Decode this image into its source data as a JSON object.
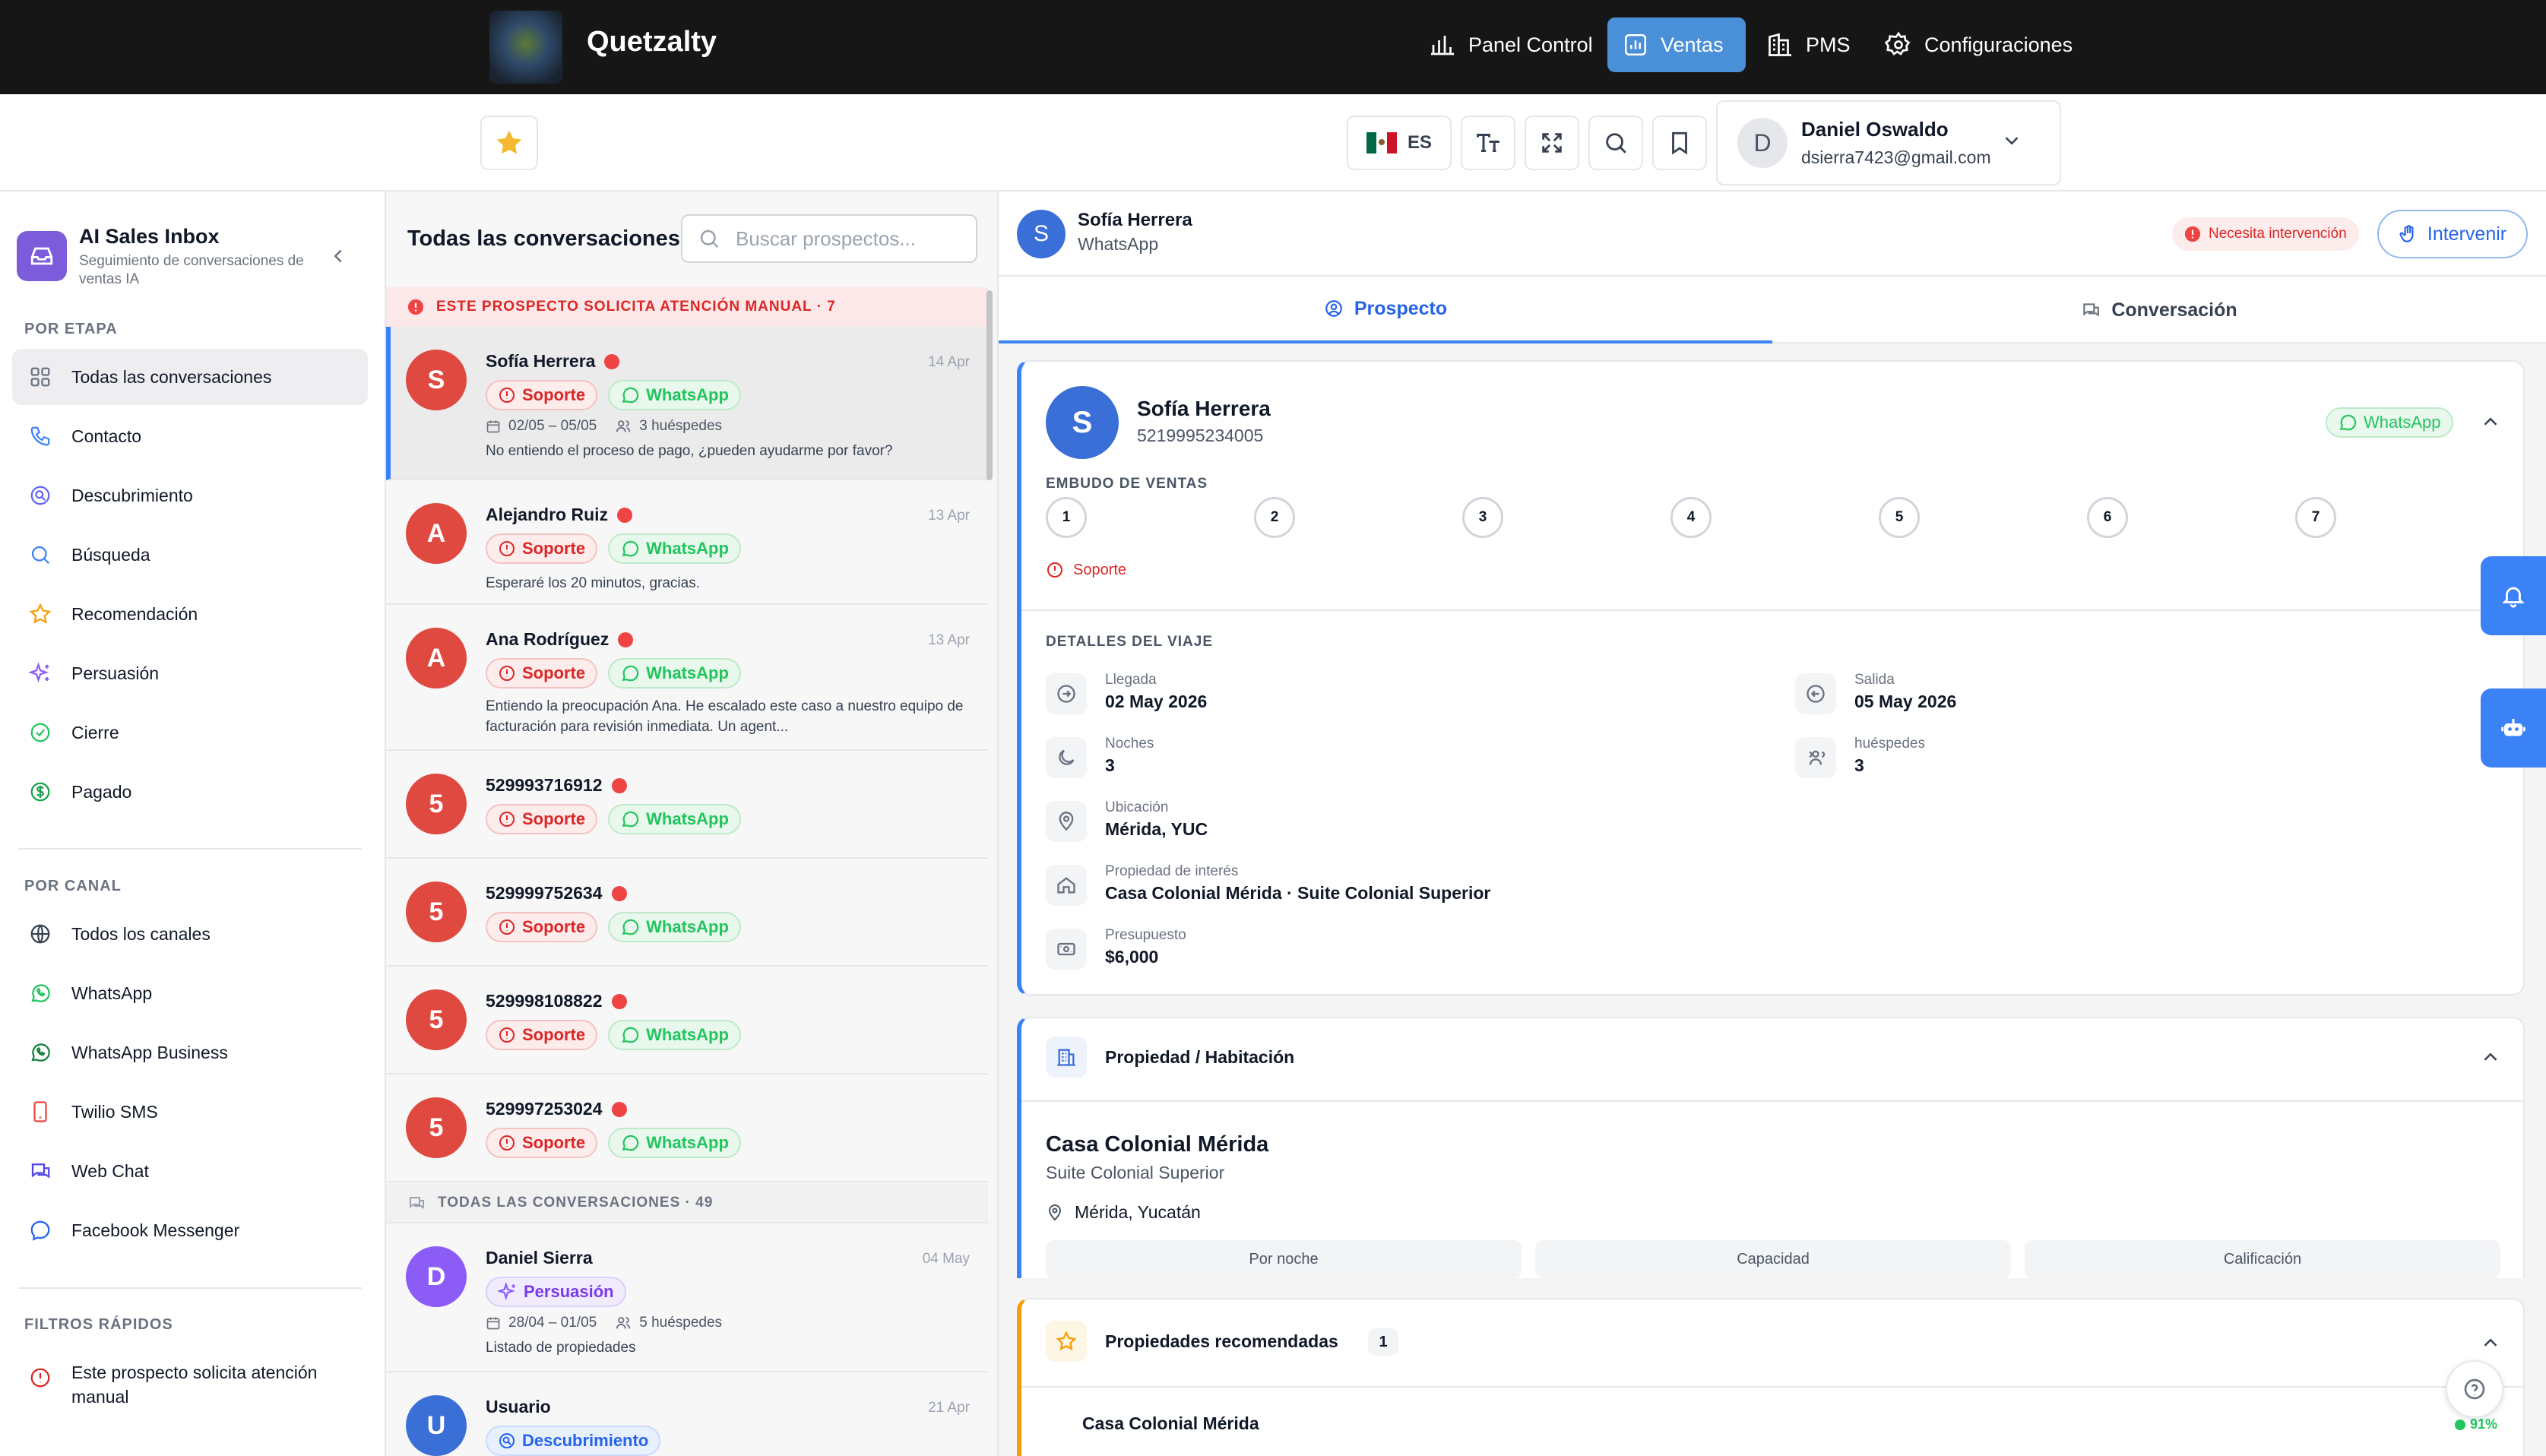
{
  "app": {
    "brand": "Quetzalty"
  },
  "nav": [
    {
      "label": "Panel Control",
      "icon": "bar-chart-icon"
    },
    {
      "label": "Ventas",
      "icon": "chart-box-icon",
      "active": true
    },
    {
      "label": "PMS",
      "icon": "building-icon"
    },
    {
      "label": "Configuraciones",
      "icon": "gear-icon"
    }
  ],
  "toolbar": {
    "lang": "ES",
    "user_initial": "D",
    "user_name": "Daniel Oswaldo",
    "user_email": "dsierra7423@gmail.com"
  },
  "sidebar": {
    "title": "AI Sales Inbox",
    "subtitle": "Seguimiento de conversaciones de ventas IA",
    "stage_header": "POR ETAPA",
    "stages": [
      "Todas las conversaciones",
      "Contacto",
      "Descubrimiento",
      "Búsqueda",
      "Recomendación",
      "Persuasión",
      "Cierre",
      "Pagado"
    ],
    "channel_header": "POR CANAL",
    "channels": [
      "Todos los canales",
      "WhatsApp",
      "WhatsApp Business",
      "Twilio SMS",
      "Web Chat",
      "Facebook Messenger"
    ],
    "quick_header": "FILTROS RÁPIDOS",
    "quick": [
      "Este prospecto solicita atención manual"
    ]
  },
  "list": {
    "title": "Todas las conversaciones",
    "search_placeholder": "Buscar prospectos...",
    "manual_header": "ESTE PROSPECTO SOLICITA ATENCIÓN MANUAL · 7",
    "all_header": "TODAS LAS CONVERSACIONES · 49",
    "rows": [
      {
        "initial": "S",
        "name": "Sofía Herrera",
        "date": "14 Apr",
        "stage": "Soporte",
        "channel": "WhatsApp",
        "dates": "02/05 – 05/05",
        "guests": "3 huéspedes",
        "snippet": "No entiendo el proceso de pago, ¿pueden ayudarme por favor?"
      },
      {
        "initial": "A",
        "name": "Alejandro Ruiz",
        "date": "13 Apr",
        "stage": "Soporte",
        "channel": "WhatsApp",
        "snippet": "Esperaré los 20 minutos, gracias."
      },
      {
        "initial": "A",
        "name": "Ana Rodríguez",
        "date": "13 Apr",
        "stage": "Soporte",
        "channel": "WhatsApp",
        "snippet": "Entiendo la preocupación Ana. He escalado este caso a nuestro equipo de facturación para revisión inmediata. Un agent..."
      },
      {
        "initial": "5",
        "name": "529993716912",
        "stage": "Soporte",
        "channel": "WhatsApp"
      },
      {
        "initial": "5",
        "name": "529999752634",
        "stage": "Soporte",
        "channel": "WhatsApp"
      },
      {
        "initial": "5",
        "name": "529998108822",
        "stage": "Soporte",
        "channel": "WhatsApp"
      },
      {
        "initial": "5",
        "name": "529997253024",
        "stage": "Soporte",
        "channel": "WhatsApp"
      },
      {
        "initial": "D",
        "name": "Daniel Sierra",
        "date": "04 May",
        "stage": "Persuasión",
        "dates": "28/04 – 01/05",
        "guests": "5 huéspedes",
        "snippet": "Listado de propiedades"
      },
      {
        "initial": "U",
        "name": "Usuario",
        "date": "21 Apr",
        "stage": "Descubrimiento"
      }
    ]
  },
  "detail": {
    "initial": "S",
    "name": "Sofía Herrera",
    "channel": "WhatsApp",
    "alert": "Necesita intervención",
    "intervene": "Intervenir",
    "tabs": [
      "Prospecto",
      "Conversación"
    ],
    "phone": "5219995234005",
    "funnel_label": "EMBUDO DE VENTAS",
    "steps": [
      "1",
      "2",
      "3",
      "4",
      "5",
      "6",
      "7"
    ],
    "stage": "Soporte",
    "trip_label": "DETALLES DEL VIAJE",
    "trip": {
      "arrival_label": "Llegada",
      "arrival": "02 May 2026",
      "departure_label": "Salida",
      "departure": "05 May 2026",
      "nights_label": "Noches",
      "nights": "3",
      "guests_label": "huéspedes",
      "guests": "3",
      "location_label": "Ubicación",
      "location": "Mérida, YUC",
      "property_label": "Propiedad de interés",
      "property": "Casa Colonial Mérida · Suite Colonial Superior",
      "budget_label": "Presupuesto",
      "budget": "$6,000"
    },
    "room_card": {
      "title": "Propiedad / Habitación",
      "name": "Casa Colonial Mérida",
      "room": "Suite Colonial Superior",
      "location": "Mérida, Yucatán",
      "metrics": [
        "Por noche",
        "Capacidad",
        "Calificación"
      ]
    },
    "rec_card": {
      "title": "Propiedades recomendadas",
      "count": "1",
      "item": "Casa Colonial Mérida",
      "score": "91%"
    }
  },
  "colors": {
    "accent": "#4a90d9",
    "whatsapp": "#22c55e",
    "danger": "#dc2626"
  }
}
